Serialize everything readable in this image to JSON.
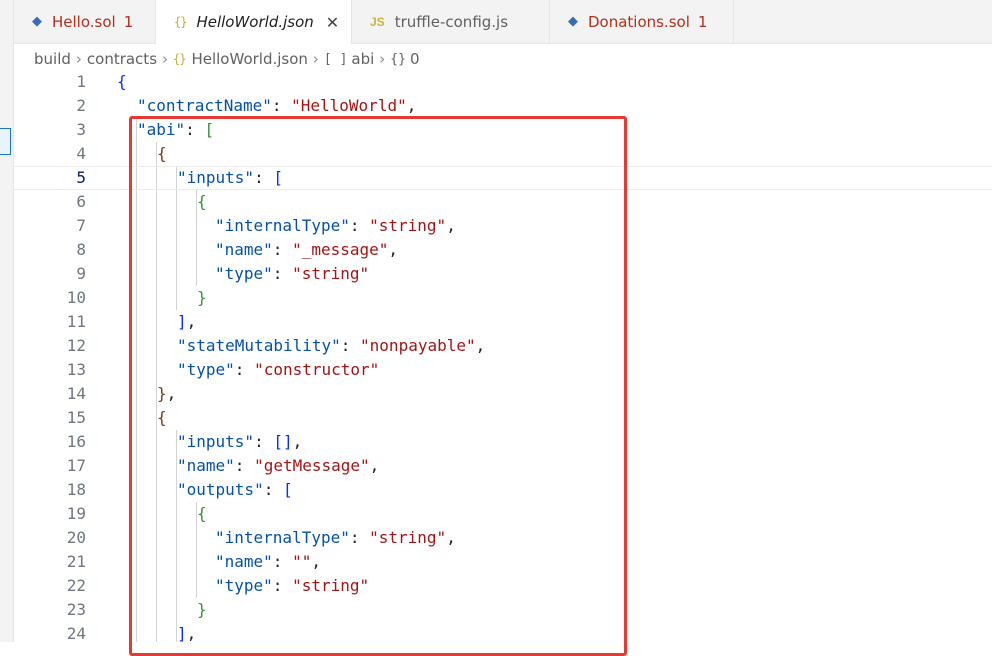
{
  "tabs": [
    {
      "label": "Hello.sol",
      "count": "1",
      "icon": "solidity-icon"
    },
    {
      "label": "HelloWorld.json",
      "icon": "json-icon",
      "close": "✕"
    },
    {
      "label": "truffle-config.js",
      "icon": "js-icon",
      "icon_text": "JS"
    },
    {
      "label": "Donations.sol",
      "count": "1",
      "icon": "solidity-icon"
    }
  ],
  "breadcrumb": {
    "items": [
      "build",
      "contracts",
      "HelloWorld.json",
      "abi",
      "0"
    ],
    "json_icon": "{}",
    "array_icon": "[ ]",
    "object_icon": "{}"
  },
  "editor": {
    "current_line": 5,
    "lines": [
      {
        "n": "1"
      },
      {
        "n": "2"
      },
      {
        "n": "3"
      },
      {
        "n": "4"
      },
      {
        "n": "5"
      },
      {
        "n": "6"
      },
      {
        "n": "7"
      },
      {
        "n": "8"
      },
      {
        "n": "9"
      },
      {
        "n": "10"
      },
      {
        "n": "11"
      },
      {
        "n": "12"
      },
      {
        "n": "13"
      },
      {
        "n": "14"
      },
      {
        "n": "15"
      },
      {
        "n": "16"
      },
      {
        "n": "17"
      },
      {
        "n": "18"
      },
      {
        "n": "19"
      },
      {
        "n": "20"
      },
      {
        "n": "21"
      },
      {
        "n": "22"
      },
      {
        "n": "23"
      },
      {
        "n": "24"
      }
    ],
    "keys": {
      "contractName": "\"contractName\"",
      "abi": "\"abi\"",
      "inputs": "\"inputs\"",
      "internalType": "\"internalType\"",
      "name": "\"name\"",
      "type": "\"type\"",
      "stateMutability": "\"stateMutability\"",
      "outputs": "\"outputs\""
    },
    "values": {
      "HelloWorld": "\"HelloWorld\"",
      "string": "\"string\"",
      "_message": "\"_message\"",
      "nonpayable": "\"nonpayable\"",
      "constructor": "\"constructor\"",
      "getMessage": "\"getMessage\"",
      "empty": "\"\""
    }
  },
  "colors": {
    "key": "#0451a5",
    "string": "#a31515",
    "highlight_box": "#e53935"
  }
}
